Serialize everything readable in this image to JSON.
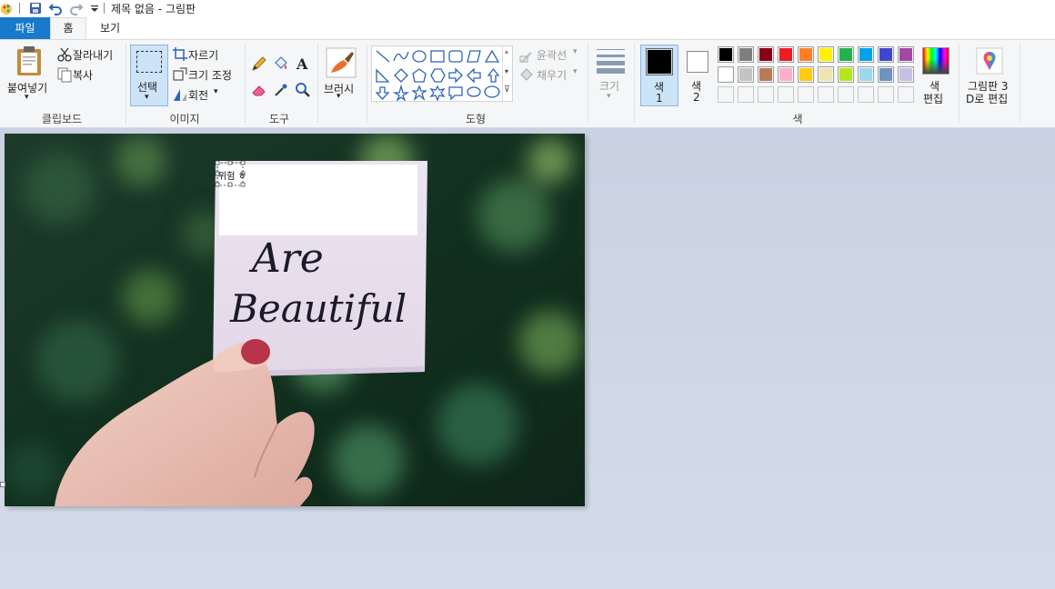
{
  "window": {
    "title": "제목 없음 - 그림판"
  },
  "tabs": {
    "file": "파일",
    "home": "홈",
    "view": "보기"
  },
  "clipboard": {
    "paste": "붙여넣기",
    "cut": "잘라내기",
    "copy": "복사",
    "label": "클립보드"
  },
  "image": {
    "select": "선택",
    "crop": "자르기",
    "resize": "크기 조정",
    "rotate": "회전",
    "label": "이미지"
  },
  "tools": {
    "label": "도구",
    "brush": "브러시"
  },
  "shapes": {
    "outline": "윤곽선",
    "fill": "채우기",
    "label": "도형"
  },
  "size": {
    "label": "크기"
  },
  "colors": {
    "color1_line1": "색",
    "color1_line2": "1",
    "color2_line1": "색",
    "color2_line2": "2",
    "edit_line1": "색",
    "edit_line2": "편집",
    "label": "색",
    "color1_value": "#000000",
    "color2_value": "#ffffff",
    "palette_row1": [
      "#000000",
      "#7f7f7f",
      "#880015",
      "#ed1c24",
      "#ff7f27",
      "#fff200",
      "#22b14c",
      "#00a2e8",
      "#3f48cc",
      "#a349a4"
    ],
    "palette_row2": [
      "#ffffff",
      "#c3c3c3",
      "#b97a57",
      "#ffaec9",
      "#ffc90e",
      "#efe4b0",
      "#b5e61d",
      "#99d9ea",
      "#7092be",
      "#c8bfe7"
    ]
  },
  "paint3d": {
    "line1": "그림판 3",
    "line2": "D로 편집"
  },
  "canvas_image": {
    "note_line1": "Are",
    "note_line2": "Beautiful",
    "selection_text": "위험 ㅎ"
  }
}
